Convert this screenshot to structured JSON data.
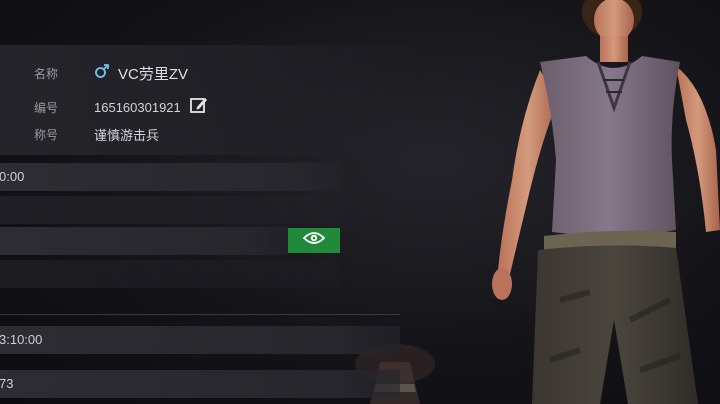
{
  "profile": {
    "name_label": "名称",
    "name_value": "VC劳里ZV",
    "id_label": "编号",
    "id_value": "165160301921",
    "title_label": "称号",
    "title_value": "谨慎游击兵"
  },
  "bars": {
    "row1_value": "0:00",
    "row2_value": "",
    "row3_value": "",
    "row4_value": "",
    "row5_value": "3:10:00",
    "row6_value": "73"
  },
  "colors": {
    "accent_green": "#1f8a3a",
    "male_icon": "#6ec6e8"
  },
  "icons": {
    "gender": "male-icon",
    "edit": "edit-icon",
    "visibility": "eye-icon"
  }
}
